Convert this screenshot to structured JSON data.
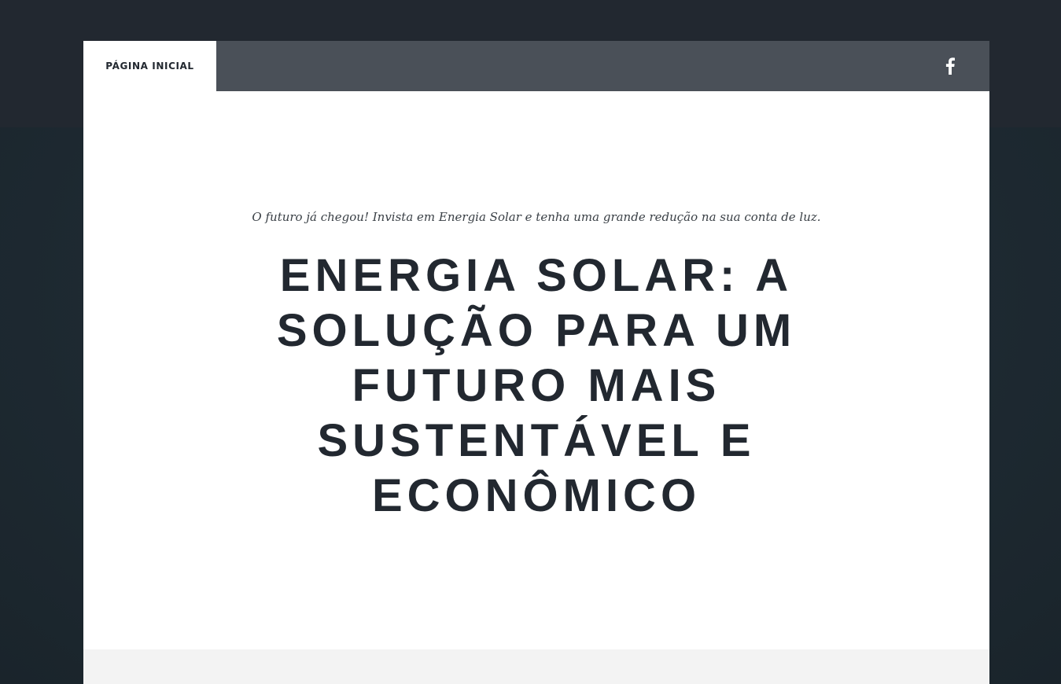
{
  "nav": {
    "home_label": "PÁGINA INICIAL",
    "social_icon": "facebook-icon"
  },
  "hero": {
    "tagline": "O futuro já chegou! Invista em Energia Solar e tenha uma grande redução na sua conta de luz.",
    "headline": "ENERGIA SOLAR: A SOLUÇÃO PARA UM FUTURO MAIS SUSTENTÁVEL E ECONÔMICO"
  },
  "colors": {
    "background": "#222830",
    "navbar": "#4a5058",
    "heading": "#222830",
    "page": "#ffffff",
    "footer_strip": "#f3f3f3"
  }
}
